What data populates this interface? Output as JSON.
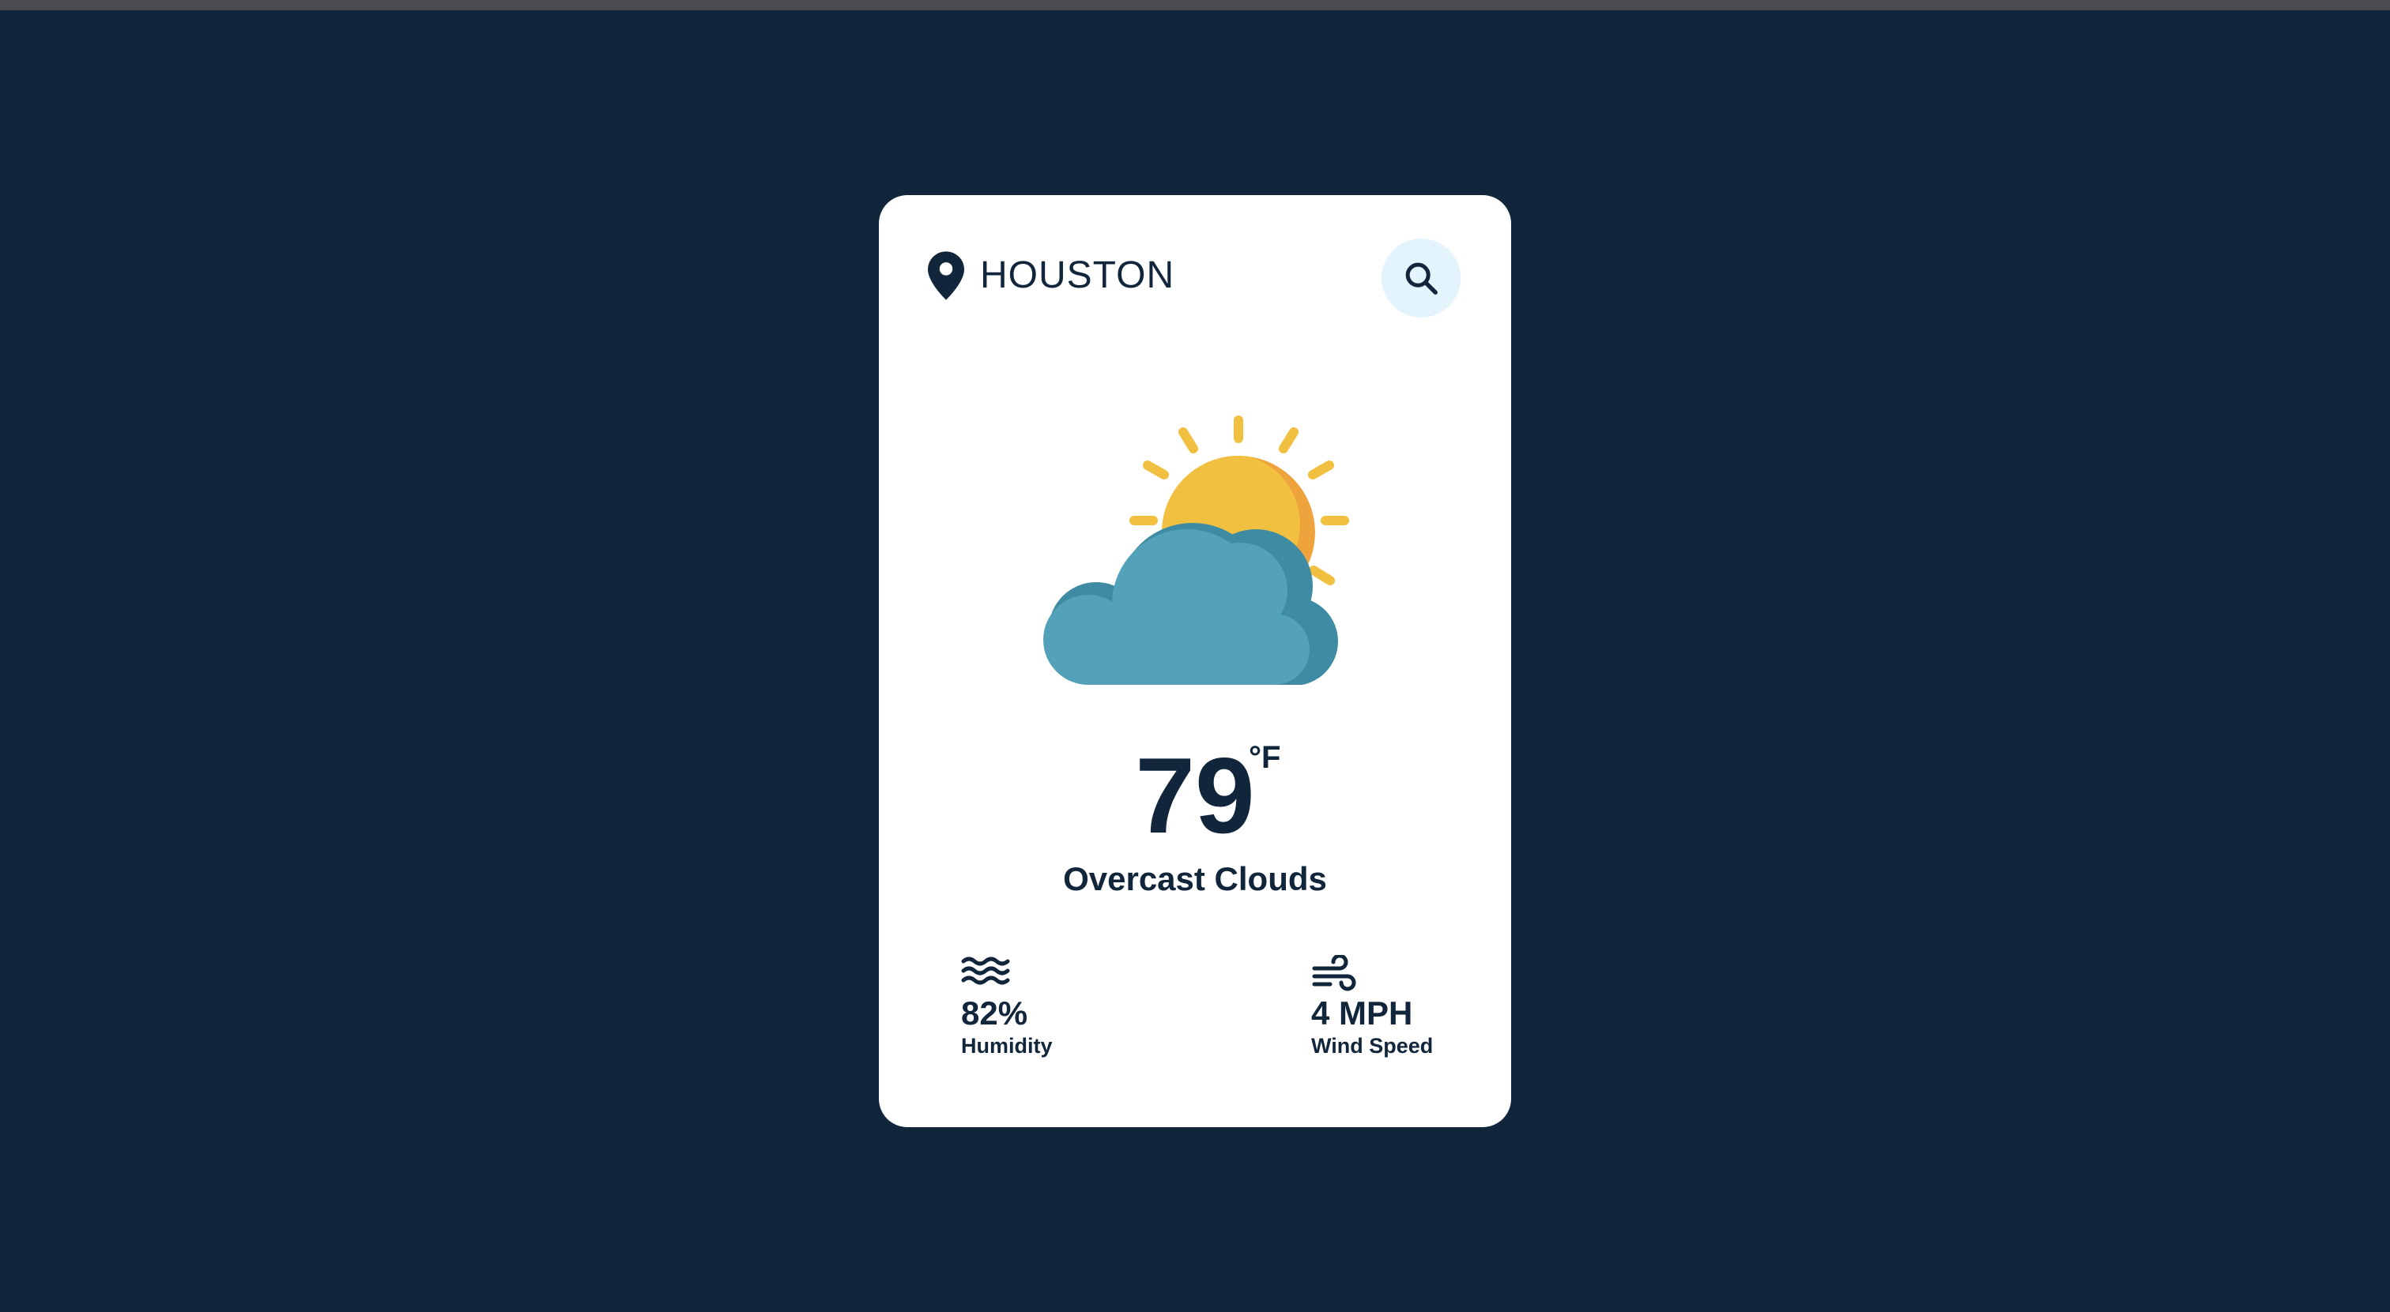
{
  "weather": {
    "city": "HOUSTON",
    "temperature": "79",
    "unit": "°F",
    "condition": "Overcast Clouds",
    "humidity": {
      "value": "82%",
      "label": "Humidity",
      "icon": "waves-icon"
    },
    "wind": {
      "value": "4 MPH",
      "label": "Wind Speed",
      "icon": "wind-icon"
    },
    "condition_icon": "sun-behind-cloud-icon",
    "location_icon": "map-pin-icon",
    "search_icon": "search-icon"
  },
  "colors": {
    "background": "#11253b",
    "card": "#ffffff",
    "text": "#11253b",
    "search_button_bg": "#e3f4fd",
    "sun": "#f2c040",
    "sun_shade": "#eea33c",
    "cloud": "#53a2b9",
    "cloud_shade": "#3f8ba3"
  }
}
